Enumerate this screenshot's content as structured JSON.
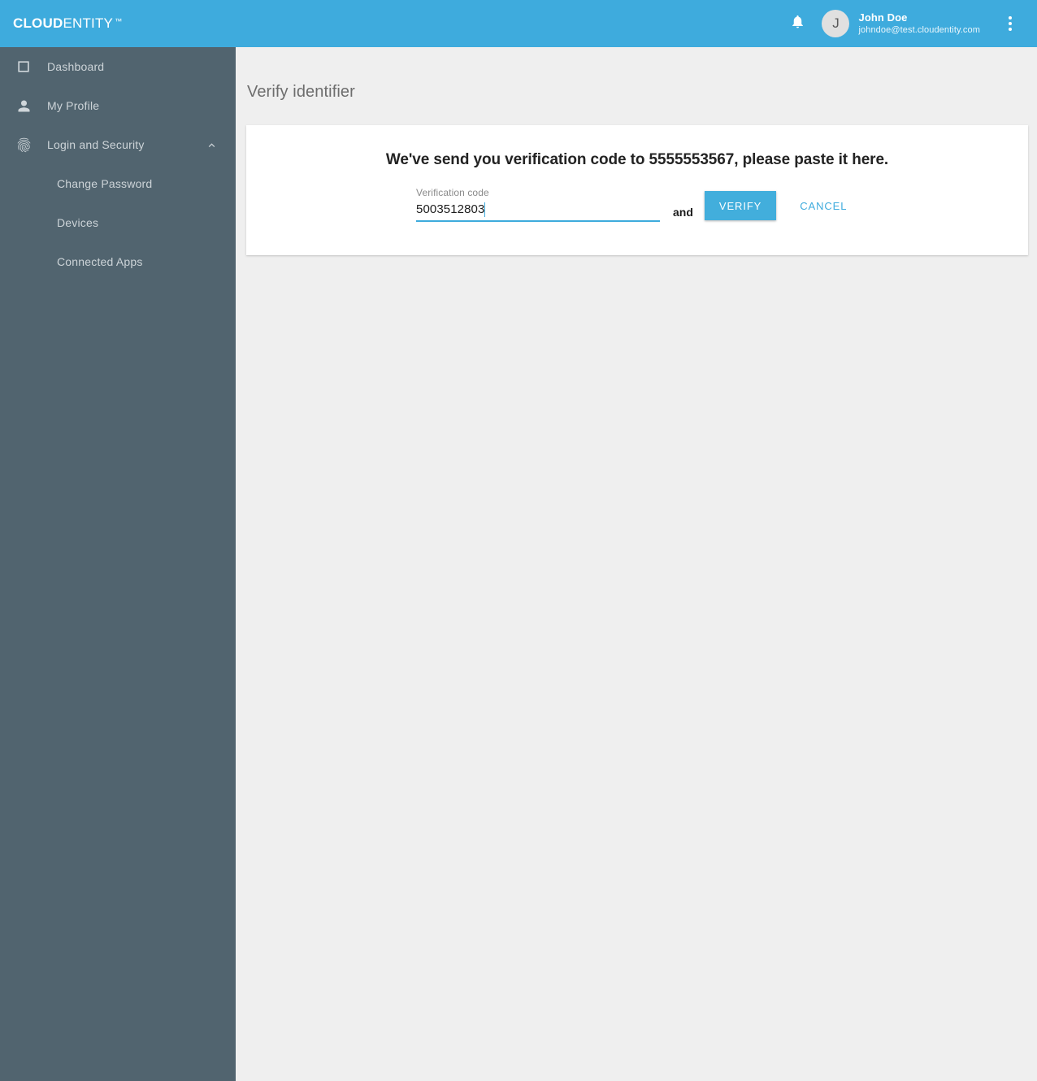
{
  "brand": {
    "name_bold": "CLOUD",
    "name_light": "ENTITY",
    "trademark": "™",
    "accent_color": "#3eabdd",
    "sidebar_color": "#51646f",
    "page_bg_color": "#efefef"
  },
  "topbar": {
    "notifications_icon": "bell-icon",
    "user": {
      "initial": "J",
      "name": "John Doe",
      "email": "johndoe@test.cloudentity.com"
    },
    "overflow_icon": "kebab-menu-icon"
  },
  "sidebar": {
    "items": [
      {
        "label": "Dashboard",
        "icon": "square-outline-icon",
        "expandable": false
      },
      {
        "label": "My Profile",
        "icon": "person-icon",
        "expandable": false
      },
      {
        "label": "Login and Security",
        "icon": "fingerprint-icon",
        "expandable": true,
        "chevron": "chevron-up-icon"
      }
    ],
    "subitems": [
      {
        "label": "Change Password"
      },
      {
        "label": "Devices"
      },
      {
        "label": "Connected Apps"
      }
    ]
  },
  "main": {
    "page_title": "Verify identifier",
    "card": {
      "heading": "We've send you verification code to 5555553567, please paste it here.",
      "field_label": "Verification code",
      "field_value": "5003512803",
      "field_placeholder": "",
      "conjunction": "and",
      "verify_label": "VERIFY",
      "cancel_label": "CANCEL"
    }
  }
}
